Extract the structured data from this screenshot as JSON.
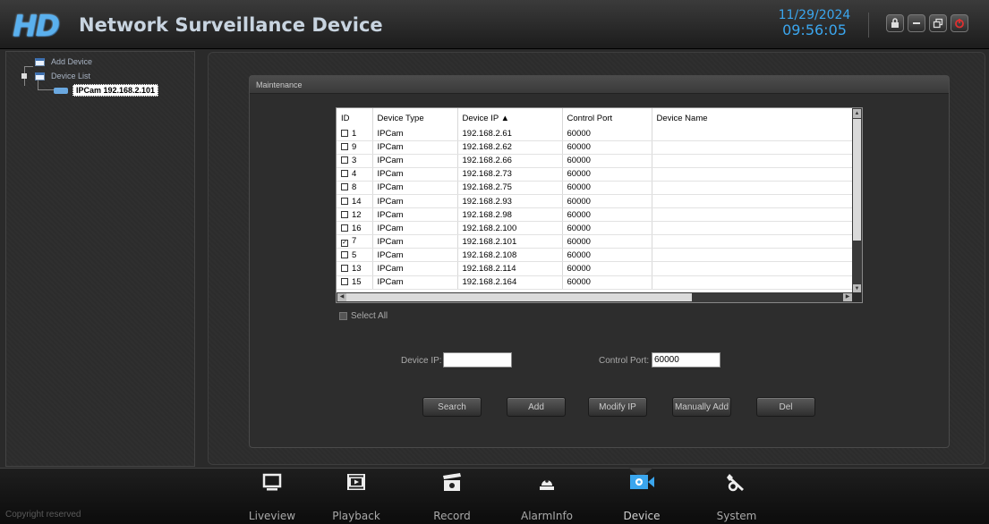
{
  "header": {
    "logo": "HD",
    "title": "Network Surveillance Device",
    "date": "11/29/2024",
    "time": "09:56:05",
    "buttons": [
      "lock-icon",
      "minimize-icon",
      "restore-icon",
      "power-icon"
    ],
    "accent_color": "#3ba6ee"
  },
  "tree": {
    "add_device": "Add Device",
    "device_list": "Device List",
    "selected_device": "IPCam 192.168.2.101"
  },
  "panel": {
    "title": "Maintenance"
  },
  "table": {
    "columns": [
      "ID",
      "Device Type",
      "Device IP ▲",
      "Control Port",
      "Device Name"
    ],
    "rows": [
      {
        "id": "1",
        "type": "IPCam",
        "ip": "192.168.2.61",
        "port": "60000",
        "name": "",
        "checked": false
      },
      {
        "id": "9",
        "type": "IPCam",
        "ip": "192.168.2.62",
        "port": "60000",
        "name": "",
        "checked": false
      },
      {
        "id": "3",
        "type": "IPCam",
        "ip": "192.168.2.66",
        "port": "60000",
        "name": "",
        "checked": false
      },
      {
        "id": "4",
        "type": "IPCam",
        "ip": "192.168.2.73",
        "port": "60000",
        "name": "",
        "checked": false
      },
      {
        "id": "8",
        "type": "IPCam",
        "ip": "192.168.2.75",
        "port": "60000",
        "name": "",
        "checked": false
      },
      {
        "id": "14",
        "type": "IPCam",
        "ip": "192.168.2.93",
        "port": "60000",
        "name": "",
        "checked": false
      },
      {
        "id": "12",
        "type": "IPCam",
        "ip": "192.168.2.98",
        "port": "60000",
        "name": "",
        "checked": false
      },
      {
        "id": "16",
        "type": "IPCam",
        "ip": "192.168.2.100",
        "port": "60000",
        "name": "",
        "checked": false
      },
      {
        "id": "7",
        "type": "IPCam",
        "ip": "192.168.2.101",
        "port": "60000",
        "name": "",
        "checked": true
      },
      {
        "id": "5",
        "type": "IPCam",
        "ip": "192.168.2.108",
        "port": "60000",
        "name": "",
        "checked": false
      },
      {
        "id": "13",
        "type": "IPCam",
        "ip": "192.168.2.114",
        "port": "60000",
        "name": "",
        "checked": false
      },
      {
        "id": "15",
        "type": "IPCam",
        "ip": "192.168.2.164",
        "port": "60000",
        "name": "",
        "checked": false
      }
    ]
  },
  "select_all": "Select All",
  "form": {
    "device_ip_label": "Device IP:",
    "device_ip_value": "",
    "control_port_label": "Control Port:",
    "control_port_value": "60000"
  },
  "buttons": {
    "search": "Search",
    "add": "Add",
    "modify_ip": "Modify IP",
    "manually_add": "Manually Add",
    "del": "Del"
  },
  "nav": {
    "items": [
      "Liveview",
      "Playback",
      "Record",
      "AlarmInfo",
      "Device",
      "System"
    ],
    "active": "Device"
  },
  "footer": {
    "copyright": "Copyright reserved"
  }
}
